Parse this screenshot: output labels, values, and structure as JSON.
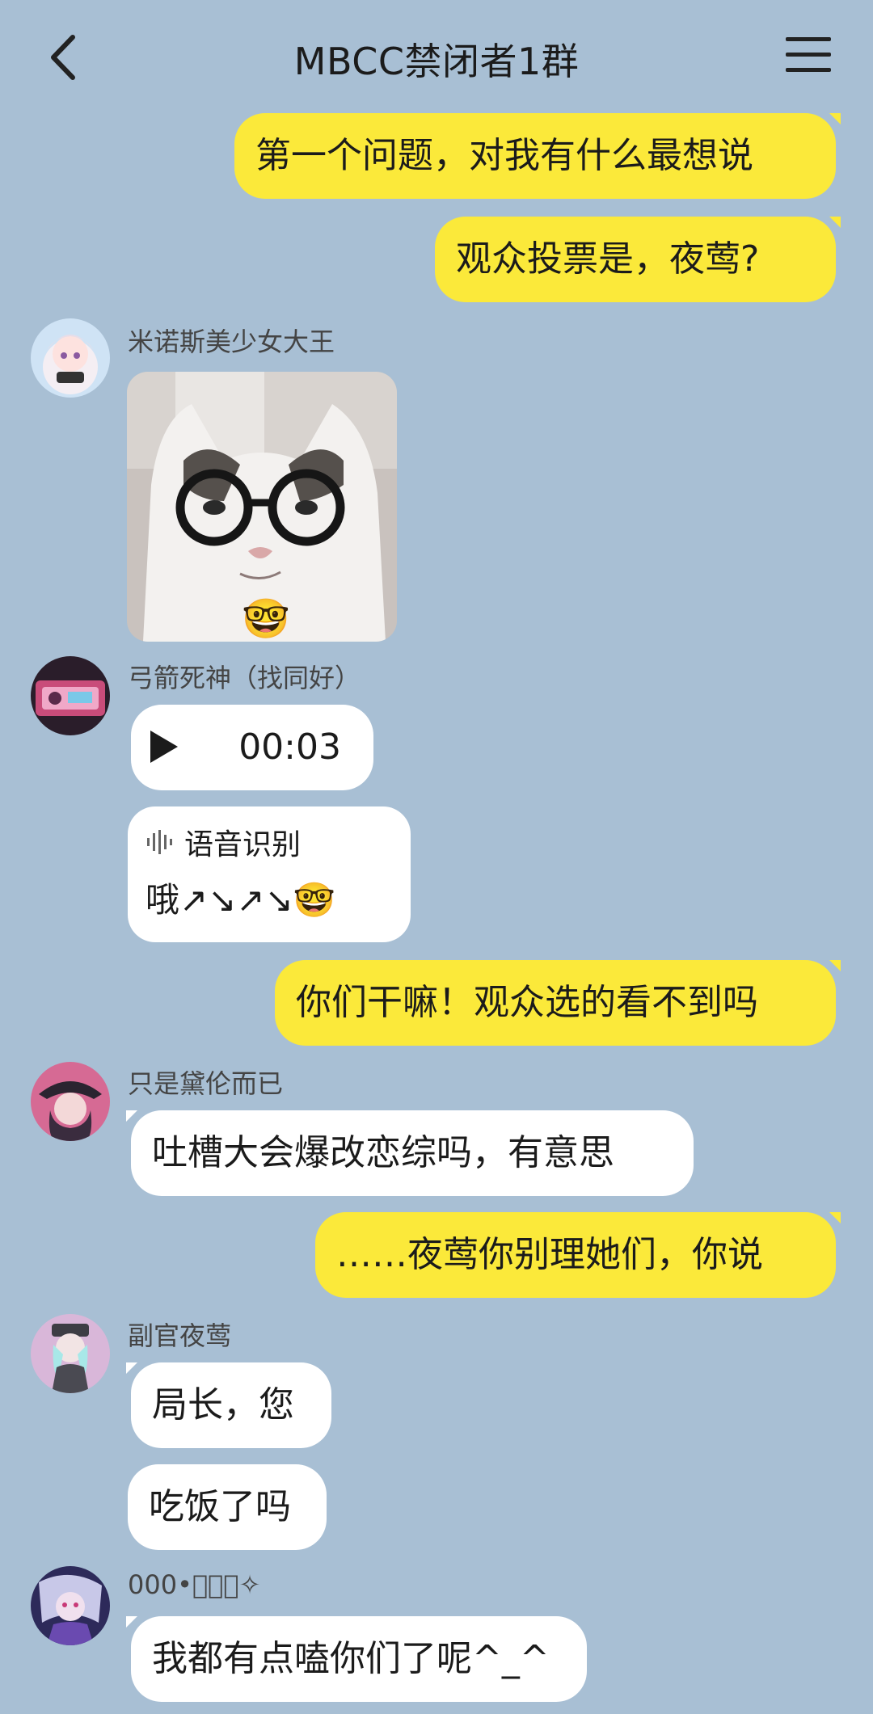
{
  "header": {
    "title": "MBCC禁闭者1群",
    "back_icon": "chevron-left-icon",
    "menu_icon": "hamburger-menu-icon"
  },
  "messages": {
    "m1": "第一个问题，对我有什么最想说",
    "m2": "观众投票是，夜莺?",
    "m3_sender": "米诺斯美少女大王",
    "m3_sticker_emoji": "🤓",
    "m4_sender": "弓箭死神（找同好）",
    "m4_voice_duration": "00:03",
    "m4_stt_label": "语音识别",
    "m4_stt_text": "哦↗↘↗↘🤓",
    "m5": "你们干嘛！观众选的看不到吗",
    "m6_sender": "只是黛伦而已",
    "m6": "吐槽大会爆改恋综吗，有意思",
    "m7": "……夜莺你别理她们，你说",
    "m8_sender": "副官夜莺",
    "m8a": "局长，您",
    "m8b": "吃饭了吗",
    "m9_sender": "000•ﾞ⸝⸝✧",
    "m9": "我都有点嗑你们了呢^_^"
  },
  "colors": {
    "background": "#a8bfd4",
    "self_bubble": "#fbe93a",
    "other_bubble": "#ffffff"
  }
}
